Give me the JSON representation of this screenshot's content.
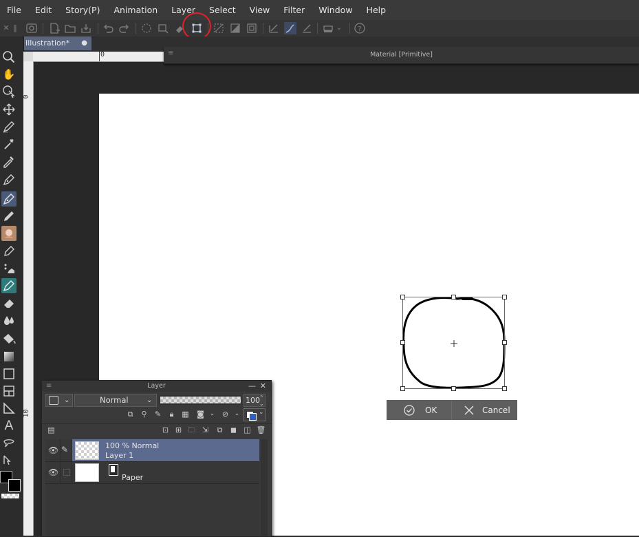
{
  "menu": [
    "File",
    "Edit",
    "Story(P)",
    "Animation",
    "Layer",
    "Select",
    "View",
    "Filter",
    "Window",
    "Help"
  ],
  "document": {
    "tab_label": "Illustration*",
    "tab_dot": "●"
  },
  "material_panel": {
    "title": "Material [Primitive]"
  },
  "rulers": {
    "top_zero": "0",
    "left_zero": "0",
    "left_ten": "10"
  },
  "transform": {
    "ok_label": "OK",
    "cancel_label": "Cancel"
  },
  "layer_panel": {
    "title": "Layer",
    "blend_mode": "Normal",
    "opacity": "100",
    "layers": [
      {
        "status": "100 % Normal",
        "name": "Layer 1",
        "selected": true
      },
      {
        "status": "",
        "name": "Paper",
        "selected": false
      }
    ]
  },
  "colors": {
    "accent_blue": "#4c5a7a",
    "selected_layer": "#5b6a8e",
    "highlight_red": "#e0202a",
    "paper": "#ffffff"
  }
}
